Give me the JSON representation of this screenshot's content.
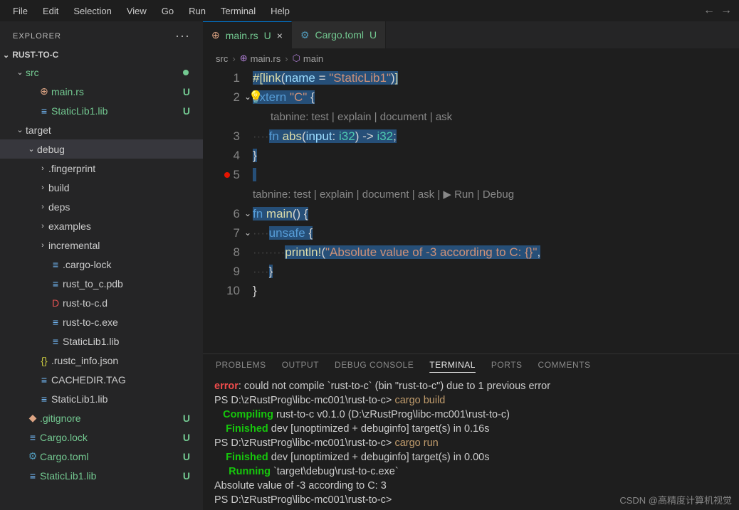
{
  "menu": [
    "File",
    "Edit",
    "Selection",
    "View",
    "Go",
    "Run",
    "Terminal",
    "Help"
  ],
  "nav": {
    "back": "←",
    "fwd": "→"
  },
  "explorer": {
    "title": "EXPLORER",
    "dots": "···"
  },
  "project": "RUST-TO-C",
  "tree": [
    {
      "depth": 1,
      "expand": "v",
      "icon": "",
      "label": "src",
      "green": true,
      "status": "●"
    },
    {
      "depth": 2,
      "icon": "⊕",
      "iconClass": "rust",
      "label": "main.rs",
      "green": true,
      "status": "U"
    },
    {
      "depth": 2,
      "icon": "≡",
      "iconClass": "file",
      "label": "StaticLib1.lib",
      "green": true,
      "status": "U"
    },
    {
      "depth": 1,
      "expand": "v",
      "label": "target"
    },
    {
      "depth": 2,
      "expand": "v",
      "label": "debug",
      "selected": true
    },
    {
      "depth": 3,
      "expand": ">",
      "label": ".fingerprint"
    },
    {
      "depth": 3,
      "expand": ">",
      "label": "build"
    },
    {
      "depth": 3,
      "expand": ">",
      "label": "deps"
    },
    {
      "depth": 3,
      "expand": ">",
      "label": "examples"
    },
    {
      "depth": 3,
      "expand": ">",
      "label": "incremental"
    },
    {
      "depth": 3,
      "icon": "≡",
      "iconClass": "file",
      "label": ".cargo-lock"
    },
    {
      "depth": 3,
      "icon": "≡",
      "iconClass": "file",
      "label": "rust_to_c.pdb"
    },
    {
      "depth": 3,
      "icon": "D",
      "iconClass": "red",
      "label": "rust-to-c.d"
    },
    {
      "depth": 3,
      "icon": "≡",
      "iconClass": "file",
      "label": "rust-to-c.exe"
    },
    {
      "depth": 3,
      "icon": "≡",
      "iconClass": "file",
      "label": "StaticLib1.lib"
    },
    {
      "depth": 2,
      "icon": "{}",
      "iconClass": "json",
      "label": ".rustc_info.json"
    },
    {
      "depth": 2,
      "icon": "≡",
      "iconClass": "file",
      "label": "CACHEDIR.TAG"
    },
    {
      "depth": 2,
      "icon": "≡",
      "iconClass": "file",
      "label": "StaticLib1.lib"
    },
    {
      "depth": 1,
      "icon": "◆",
      "iconClass": "rust",
      "label": ".gitignore",
      "green": true,
      "status": "U"
    },
    {
      "depth": 1,
      "icon": "≡",
      "iconClass": "file",
      "label": "Cargo.lock",
      "green": true,
      "status": "U"
    },
    {
      "depth": 1,
      "icon": "⚙",
      "iconClass": "gear",
      "label": "Cargo.toml",
      "green": true,
      "status": "U"
    },
    {
      "depth": 1,
      "icon": "≡",
      "iconClass": "file",
      "label": "StaticLib1.lib",
      "green": true,
      "status": "U"
    }
  ],
  "tabs": [
    {
      "icon": "⊕",
      "iconClass": "rust",
      "label": "main.rs",
      "status": "U",
      "active": true,
      "close": "×"
    },
    {
      "icon": "⚙",
      "iconClass": "gear",
      "label": "Cargo.toml",
      "status": "U",
      "active": false
    }
  ],
  "breadcrumbs": [
    {
      "label": "src"
    },
    {
      "icon": "⊕",
      "label": "main.rs"
    },
    {
      "icon": "⬡",
      "label": "main"
    }
  ],
  "code": {
    "lines": [
      {
        "n": 1,
        "html": "<span class='sel'><span class='tok-attr'>#[link</span><span class='tok-punct'>(</span><span class='tok-ident'>name</span><span class='tok-punct'> = </span><span class='tok-str'>\"StaticLib1\"</span><span class='tok-punct'>)</span><span class='tok-attr'>]</span></span>"
      },
      {
        "n": 2,
        "fold": "v",
        "bulb": true,
        "html": "<span class='sel'><span class='tok-kw'>extern</span> <span class='tok-str'>\"C\"</span> <span class='tok-punct'>{</span></span>"
      },
      {
        "tabnine": "tabnine: test | explain | document | ask"
      },
      {
        "n": 3,
        "html": "<span style='color:#404040'>····</span><span class='sel'><span class='tok-kw'>fn</span> <span class='tok-fn'>abs</span><span class='tok-punct'>(</span><span class='tok-ident'>input</span><span class='tok-punct'>:</span> <span class='tok-type'>i32</span><span class='tok-punct'>)</span> <span class='tok-punct'>-></span> <span class='tok-type'>i32</span><span class='tok-punct'>;</span></span>"
      },
      {
        "n": 4,
        "html": "<span class='sel'><span class='tok-punct'>}</span></span>"
      },
      {
        "n": 5,
        "bp": true,
        "html": "<span class='sel'> </span>"
      },
      {
        "tabnine2": "tabnine: test | explain | document | ask | ▶ Run | Debug"
      },
      {
        "n": 6,
        "fold": "v",
        "html": "<span class='sel'><span class='tok-kw'>fn</span> <span class='tok-fn'>main</span><span class='tok-punct'>()</span> <span class='tok-punct'>{</span></span>"
      },
      {
        "n": 7,
        "fold": "v",
        "html": "<span style='color:#404040'>····</span><span class='sel'><span class='tok-kw'>unsafe</span> <span class='tok-punct'>{</span></span>"
      },
      {
        "n": 8,
        "html": "<span style='color:#404040'>········</span><span class='sel'><span class='tok-macro'>println!</span><span class='tok-punct'>(</span><span class='tok-str'>\"Absolute value of -3 according to C: {}\"</span><span class='tok-punct'>,</span></span>"
      },
      {
        "n": 9,
        "html": "<span style='color:#404040'>····</span><span class='sel'><span class='tok-punct'>}</span></span>"
      },
      {
        "n": 10,
        "html": "<span class='tok-punct'>}</span>"
      }
    ]
  },
  "termTabs": [
    "PROBLEMS",
    "OUTPUT",
    "DEBUG CONSOLE",
    "TERMINAL",
    "PORTS",
    "COMMENTS"
  ],
  "termActive": "TERMINAL",
  "terminal": [
    {
      "type": "err-line",
      "prefix": "error",
      "text": ": could not compile `rust-to-c` (bin \"rust-to-c\") due to 1 previous error"
    },
    {
      "type": "prompt",
      "path": "PS D:\\zRustProg\\libc-mc001\\rust-to-c> ",
      "cmd": "cargo build"
    },
    {
      "type": "status",
      "word": "Compiling",
      "rest": " rust-to-c v0.1.0 (D:\\zRustProg\\libc-mc001\\rust-to-c)"
    },
    {
      "type": "status",
      "word": "Finished",
      "rest": " dev [unoptimized + debuginfo] target(s) in 0.16s",
      "indent": true
    },
    {
      "type": "prompt",
      "path": "PS D:\\zRustProg\\libc-mc001\\rust-to-c> ",
      "cmd": "cargo run"
    },
    {
      "type": "status",
      "word": "Finished",
      "rest": " dev [unoptimized + debuginfo] target(s) in 0.00s",
      "indent": true
    },
    {
      "type": "status",
      "word": "Running",
      "rest": " `target\\debug\\rust-to-c.exe`",
      "indent": true,
      "indent2": true
    },
    {
      "type": "plain",
      "text": "Absolute value of -3 according to C: 3"
    },
    {
      "type": "prompt",
      "path": "PS D:\\zRustProg\\libc-mc001\\rust-to-c> ",
      "cmd": ""
    }
  ],
  "watermark": "CSDN @高精度计算机视觉"
}
